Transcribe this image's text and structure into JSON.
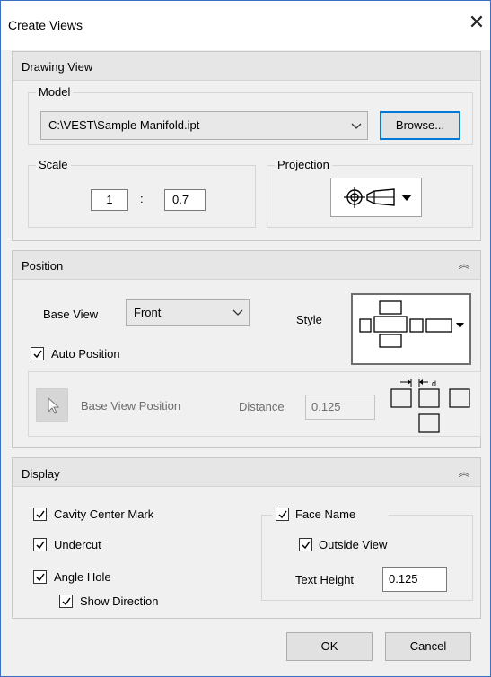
{
  "window": {
    "title": "Create Views",
    "close_icon": "close-icon"
  },
  "drawing_view": {
    "title": "Drawing View",
    "model": {
      "label": "Model",
      "value": "C:\\VEST\\Sample Manifold.ipt",
      "browse_label": "Browse..."
    },
    "scale": {
      "label": "Scale",
      "left": "1",
      "separator": ":",
      "right": "0.7"
    },
    "projection": {
      "label": "Projection",
      "icon": "third-angle-projection-icon"
    }
  },
  "position": {
    "title": "Position",
    "base_view_label": "Base View",
    "base_view_value": "Front",
    "style_label": "Style",
    "auto_position_label": "Auto Position",
    "auto_position_checked": true,
    "base_view_position_label": "Base View Position",
    "distance_label": "Distance",
    "distance_value": "0.125",
    "distance_diagram_letter": "d"
  },
  "display": {
    "title": "Display",
    "cavity_center_mark": {
      "label": "Cavity Center Mark",
      "checked": true
    },
    "undercut": {
      "label": "Undercut",
      "checked": true
    },
    "angle_hole": {
      "label": "Angle Hole",
      "checked": true
    },
    "show_direction": {
      "label": "Show Direction",
      "checked": true
    },
    "face_name": {
      "label": "Face Name",
      "checked": true
    },
    "outside_view": {
      "label": "Outside View",
      "checked": true
    },
    "text_height_label": "Text Height",
    "text_height_value": "0.125"
  },
  "footer": {
    "ok_label": "OK",
    "cancel_label": "Cancel"
  }
}
